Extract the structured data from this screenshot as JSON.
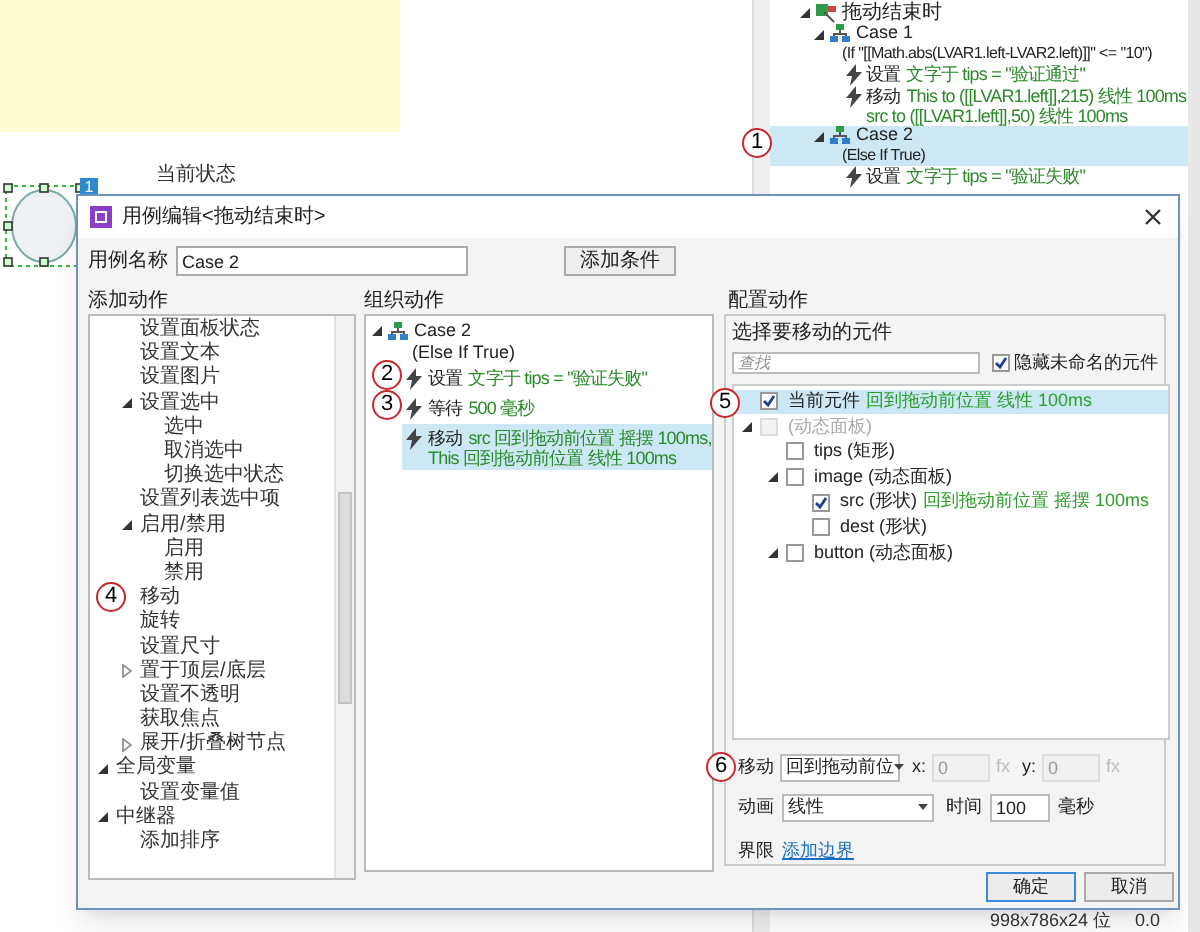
{
  "background": {
    "canvas_label": "当前状态",
    "widget_badge": "1",
    "interactions": {
      "event": "拖动结束时",
      "cases": [
        {
          "name": "Case 1",
          "condition": "(If \"[[Math.abs(LVAR1.left-LVAR2.left)]]\" <= \"10\")",
          "selected": false,
          "actions": [
            {
              "verb": "设置",
              "detail": [
                "文字于 tips = \"验证通过\""
              ]
            },
            {
              "verb": "移动",
              "detail": [
                "This to ([[LVAR1.left]],215) 线性 100ms,",
                "src to ([[LVAR1.left]],50) 线性 100ms"
              ]
            }
          ]
        },
        {
          "name": "Case 2",
          "condition": "(Else If True)",
          "selected": true,
          "marker": "1",
          "actions": [
            {
              "verb": "设置",
              "detail": [
                "文字于 tips = \"验证失败\""
              ]
            }
          ]
        }
      ]
    },
    "status": [
      "998x786x24 位",
      "0.0"
    ]
  },
  "dialog": {
    "title": "用例编辑<拖动结束时>",
    "case_name_label": "用例名称",
    "case_name": "Case 2",
    "add_condition_button": "添加条件",
    "add_actions": {
      "header": "添加动作",
      "continued_items": [
        {
          "label": "设置面板状态"
        },
        {
          "label": "设置文本"
        },
        {
          "label": "设置图片"
        },
        {
          "label": "设置选中",
          "expanded": true,
          "children": [
            {
              "label": "选中"
            },
            {
              "label": "取消选中"
            },
            {
              "label": "切换选中状态"
            }
          ]
        },
        {
          "label": "设置列表选中项"
        },
        {
          "label": "启用/禁用",
          "expanded": true,
          "children": [
            {
              "label": "启用"
            },
            {
              "label": "禁用"
            }
          ]
        },
        {
          "label": "移动",
          "marker": "4"
        },
        {
          "label": "旋转"
        },
        {
          "label": "设置尺寸"
        },
        {
          "label": "置于顶层/底层",
          "expanded": false
        },
        {
          "label": "设置不透明"
        },
        {
          "label": "获取焦点"
        },
        {
          "label": "展开/折叠树节点",
          "expanded": false
        }
      ],
      "items": [
        {
          "label": "全局变量",
          "expanded": true,
          "children": [
            {
              "label": "设置变量值"
            }
          ]
        },
        {
          "label": "中继器",
          "expanded": true,
          "children": [
            {
              "label": "添加排序"
            }
          ]
        }
      ]
    },
    "organize": {
      "header": "组织动作",
      "case": {
        "name": "Case 2",
        "condition": "(Else If True)",
        "expanded": true
      },
      "actions": [
        {
          "verb": "设置",
          "detail": [
            "文字于 tips = \"验证失败\""
          ],
          "selected": false,
          "marker": "2"
        },
        {
          "verb": "等待",
          "detail": [
            "500 毫秒"
          ],
          "selected": false,
          "marker": "3"
        },
        {
          "verb": "移动",
          "detail": [
            "src 回到拖动前位置 摇摆 100ms,",
            "This 回到拖动前位置 线性 100ms"
          ],
          "selected": true
        }
      ]
    },
    "configure": {
      "header": "配置动作",
      "prompt": "选择要移动的元件",
      "search_placeholder": "查找",
      "hide_unnamed": {
        "label": "隐藏未命名的元件",
        "checked": true
      },
      "widgets": [
        {
          "label": "当前元件",
          "detail": "回到拖动前位置 线性 100ms",
          "checked": true,
          "selected": true,
          "disabled": false,
          "marker": "5"
        },
        {
          "label": "(动态面板)",
          "checked": false,
          "selected": false,
          "disabled": true,
          "expanded": true,
          "children": [
            {
              "label": "tips (矩形)",
              "checked": false,
              "selected": false,
              "disabled": false
            },
            {
              "label": "image (动态面板)",
              "checked": false,
              "selected": false,
              "disabled": false,
              "expanded": true,
              "children": [
                {
                  "label": "src (形状)",
                  "detail": "回到拖动前位置 摇摆 100ms",
                  "checked": true,
                  "selected": false,
                  "disabled": false
                },
                {
                  "label": "dest (形状)",
                  "checked": false,
                  "selected": false,
                  "disabled": false
                }
              ]
            },
            {
              "label": "button (动态面板)",
              "checked": false,
              "selected": false,
              "disabled": false,
              "expanded": true
            }
          ]
        }
      ],
      "move_marker": "6",
      "move_label": "移动",
      "move_select": "回到拖动前位",
      "x_label": "x:",
      "x_value": "0",
      "y_label": "y:",
      "y_value": "0",
      "fx": [
        "fx",
        "fx"
      ],
      "coords_disabled": true,
      "animation_label": "动画",
      "animation_select": "线性",
      "time_label": "时间",
      "time_value": "100",
      "ms_label": "毫秒",
      "bounds_label": "界限",
      "bounds_link": "添加边界"
    },
    "buttons": [
      "确定",
      "取消"
    ]
  }
}
